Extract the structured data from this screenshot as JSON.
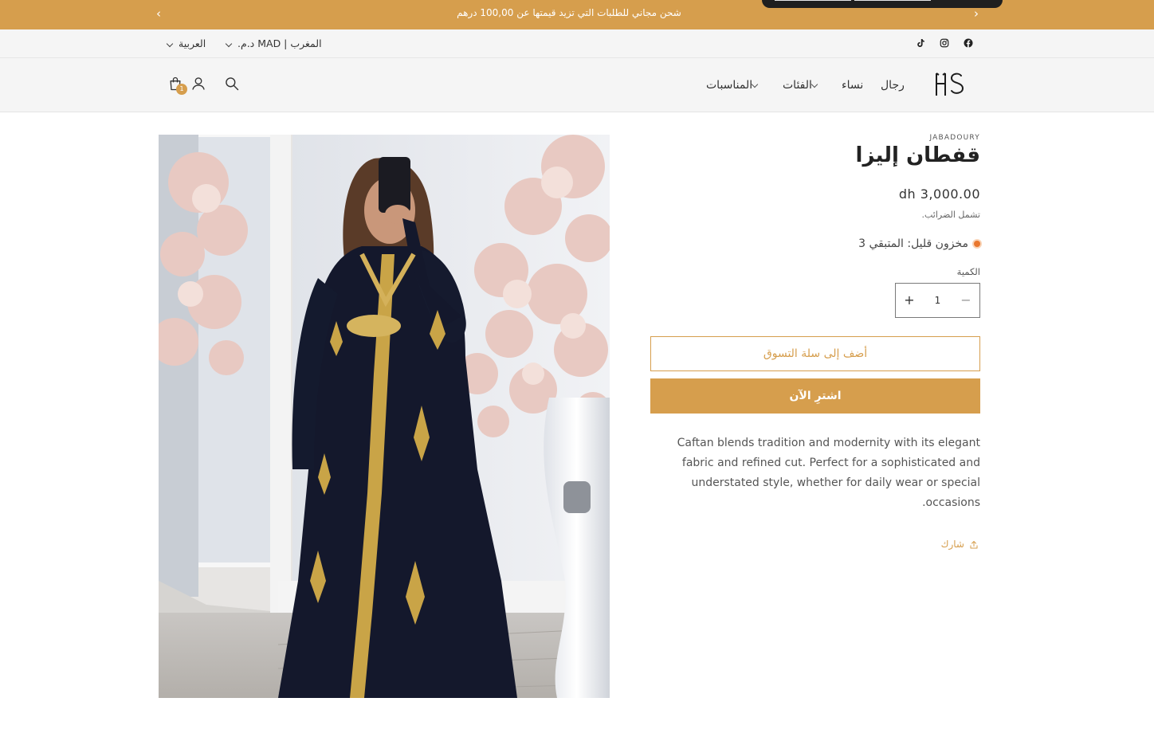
{
  "announcement": {
    "message": "شحن مجاني للطلبات التي تزيد قيمتها عن 100,00 درهم",
    "prev_arrow": "‹",
    "next_arrow": "›"
  },
  "utility": {
    "language": "العربية",
    "currency": "المغرب | MAD د.م.",
    "social_icons": [
      "tiktok-icon",
      "instagram-icon",
      "facebook-icon"
    ]
  },
  "header": {
    "logo_text": "HS",
    "nav": [
      {
        "label": "رجال"
      },
      {
        "label": "نساء"
      },
      {
        "label": "الفئات",
        "dropdown": true
      },
      {
        "label": "المناسبات",
        "dropdown": true
      }
    ],
    "cart_count": "1",
    "icons": [
      "search-icon",
      "account-icon",
      "cart-icon"
    ]
  },
  "product": {
    "vendor": "JABADOURY",
    "title": "قفطان إليزا",
    "price": "dh 3,000.00",
    "tax_note": "تشمل الضرائب.",
    "stock": "مخزون قليل: المتبقي 3",
    "quantity_label": "الكمية",
    "quantity": "1",
    "plus": "+",
    "minus": "−",
    "add_to_cart": "أضف إلى سلة التسوق",
    "buy_now": "اشترِ الآن",
    "description": "Caftan blends tradition and modernity with its elegant fabric and refined cut. Perfect for a sophisticated and understated style, whether for daily wear or special occasions.",
    "share": "شارك"
  },
  "colors": {
    "accent": "#d69e4d",
    "header_bg": "#f5f5f5",
    "stock_dot": "#e9772e"
  }
}
